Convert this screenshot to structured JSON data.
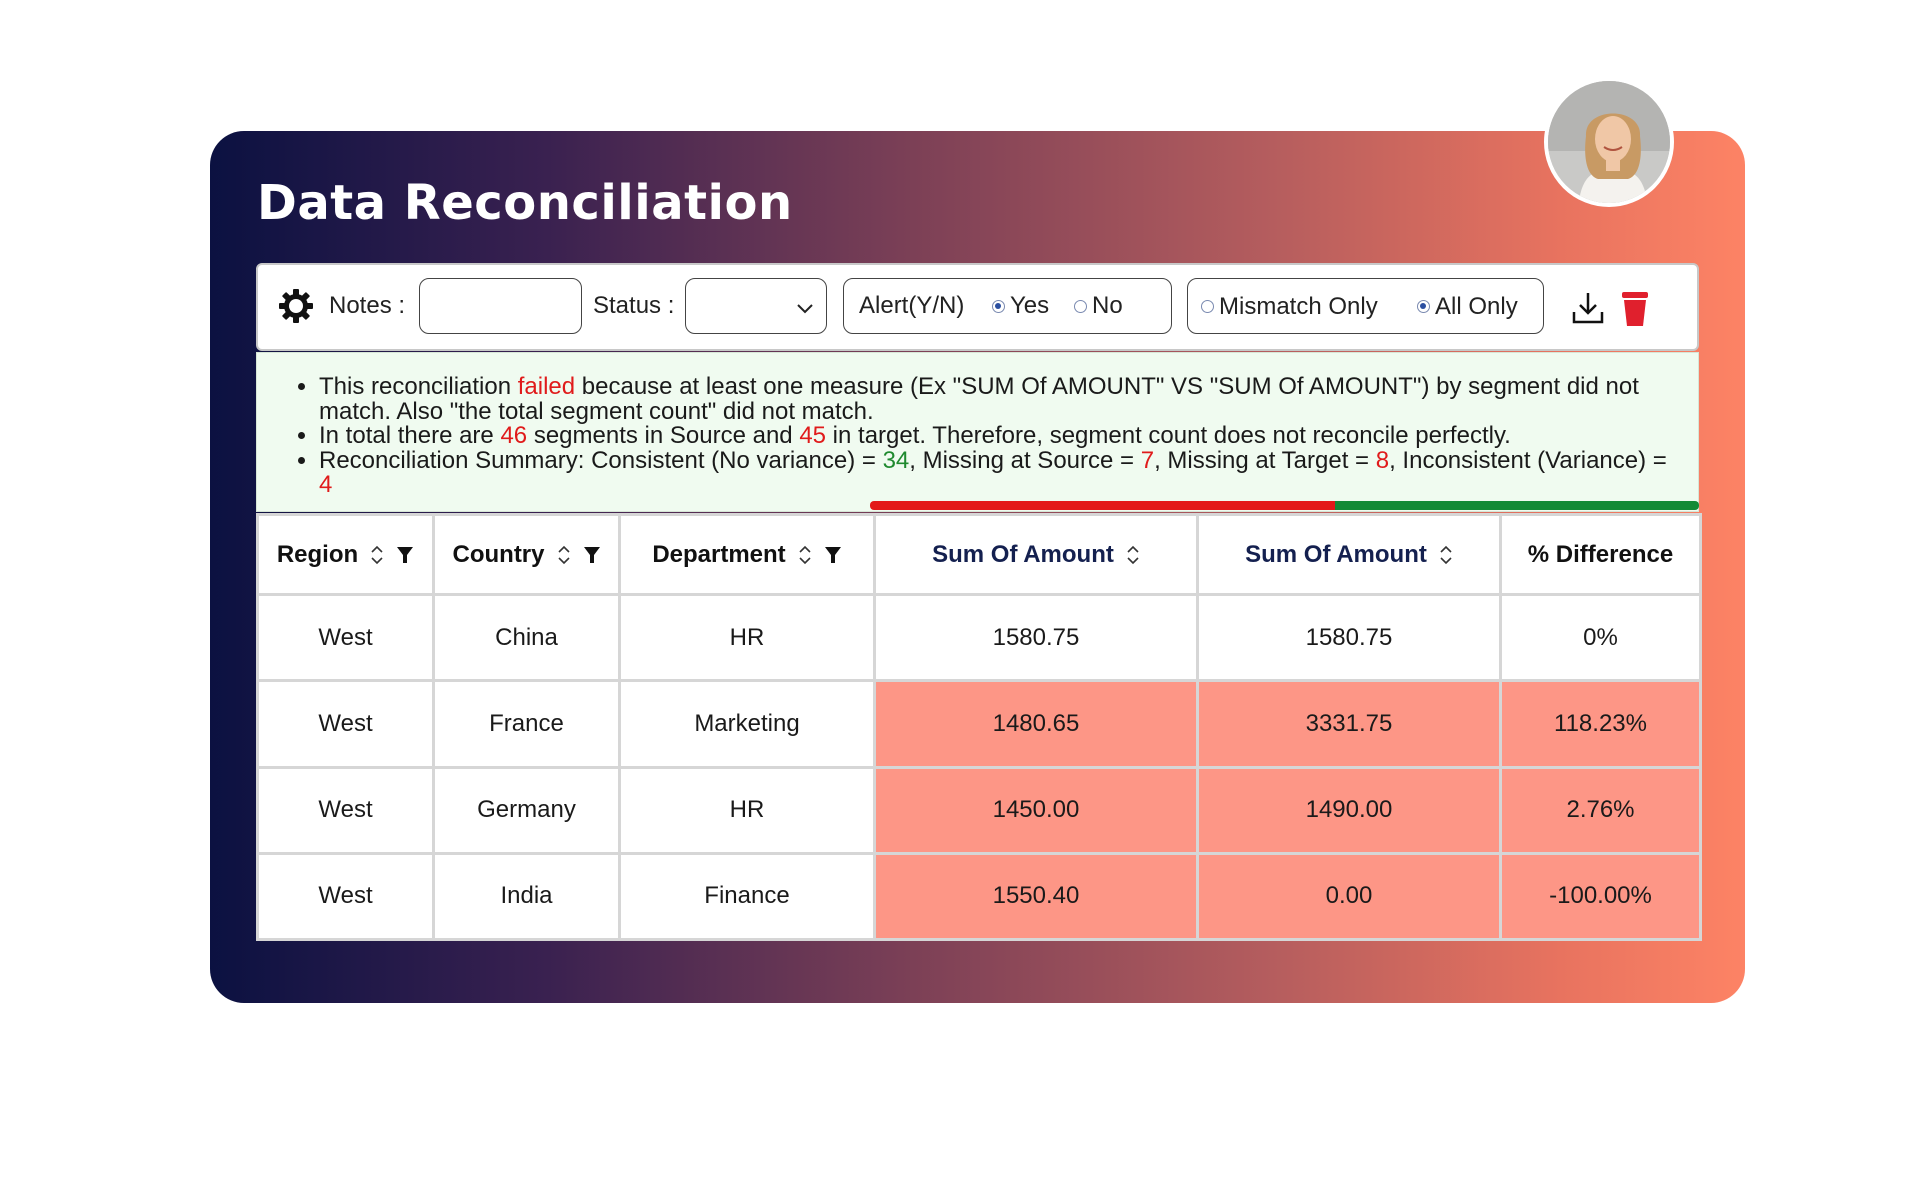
{
  "app": {
    "title": "Data Reconciliation"
  },
  "toolbar": {
    "settings_icon": "gear-icon",
    "notes_label": "Notes :",
    "notes_value": "",
    "status_label": "Status :",
    "status_value": "",
    "alert_label": "Alert(Y/N)",
    "alert_options": [
      {
        "label": "Yes",
        "selected": true
      },
      {
        "label": "No",
        "selected": false
      }
    ],
    "filter_options": [
      {
        "label": "Mismatch Only",
        "selected": false
      },
      {
        "label": "All Only",
        "selected": true
      }
    ],
    "download_icon": "download-icon",
    "delete_icon": "trash-icon"
  },
  "summary": {
    "line1_a": "This reconciliation ",
    "line1_fail": "failed",
    "line1_b": " because at least one measure (Ex \"SUM Of AMOUNT\" VS \"SUM Of AMOUNT\") by segment did not match. Also \"the total segment count\" did not match.",
    "line2_a": "In total there are ",
    "source_count": "46",
    "line2_b": " segments in Source and ",
    "target_count": "45",
    "line2_c": " in target. Therefore, segment count does not reconcile perfectly.",
    "line3_a": "Reconciliation Summary: Consistent (No variance) = ",
    "consistent": "34",
    "line3_b": ", Missing at Source = ",
    "missing_source": "7",
    "line3_c": ", Missing at Target = ",
    "missing_target": "8",
    "line3_d": ", Inconsistent (Variance) = ",
    "inconsistent": "4"
  },
  "table": {
    "headers": [
      "Region",
      "Country",
      "Department",
      "Sum Of Amount",
      "Sum Of Amount",
      "% Difference"
    ],
    "rows": [
      {
        "region": "West",
        "country": "China",
        "department": "HR",
        "source": "1580.75",
        "target": "1580.75",
        "diff": "0%",
        "mismatch": false
      },
      {
        "region": "West",
        "country": "France",
        "department": "Marketing",
        "source": "1480.65",
        "target": "3331.75",
        "diff": "118.23%",
        "mismatch": true
      },
      {
        "region": "West",
        "country": "Germany",
        "department": "HR",
        "source": "1450.00",
        "target": "1490.00",
        "diff": "2.76%",
        "mismatch": true
      },
      {
        "region": "West",
        "country": "India",
        "department": "Finance",
        "source": "1550.40",
        "target": "0.00",
        "diff": "-100.00%",
        "mismatch": true
      }
    ]
  },
  "colors": {
    "mismatch_fill": "#fd9686",
    "failed_text": "#e01b1b",
    "ok_text": "#1f8a2f",
    "progress_red": "#e31919",
    "progress_green": "#138a36"
  }
}
